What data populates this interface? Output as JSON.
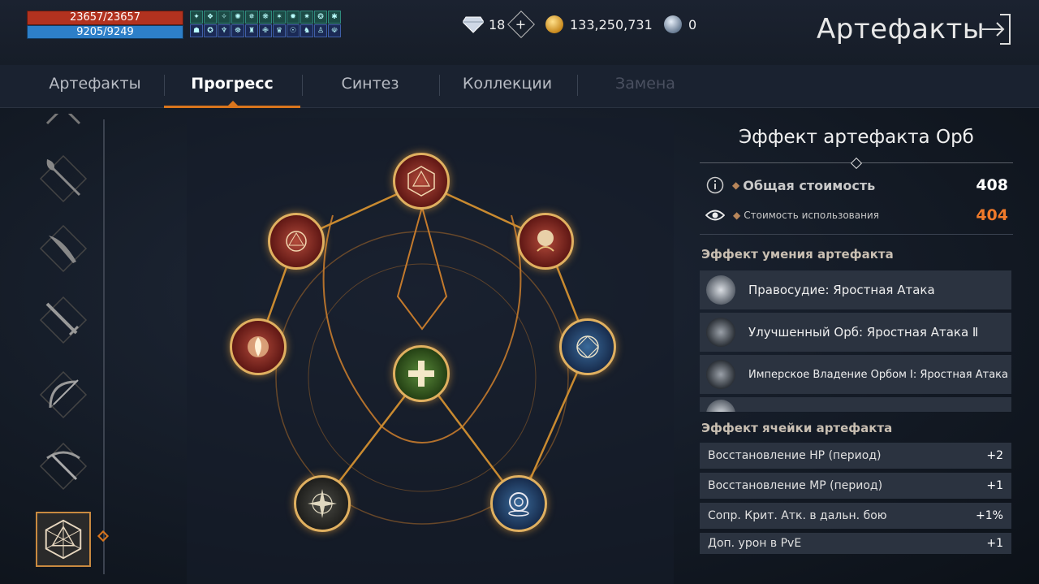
{
  "player": {
    "hp": "23657/23657",
    "mp": "9205/9249"
  },
  "buffs": [
    "✦",
    "❖",
    "✧",
    "✺",
    "✵",
    "❋",
    "✶",
    "✹",
    "✷",
    "❂",
    "✱",
    "☗",
    "✪",
    "♆",
    "☸",
    "♜",
    "✙",
    "♛",
    "☉",
    "♞",
    "♙",
    "☫"
  ],
  "currency": {
    "diamonds": "18",
    "gold": "133,250,731",
    "silver": "0"
  },
  "page_title": "Артефакты",
  "tabs": [
    {
      "label": "Артефакты",
      "state": "normal"
    },
    {
      "label": "Прогресс",
      "state": "active"
    },
    {
      "label": "Синтез",
      "state": "normal"
    },
    {
      "label": "Коллекции",
      "state": "normal"
    },
    {
      "label": "Замена",
      "state": "disabled"
    }
  ],
  "weapons": [
    "staff-icon",
    "halberd-icon",
    "dagger-icon",
    "sword-icon",
    "bow-icon",
    "crossbow-icon",
    "orb-icon"
  ],
  "panel": {
    "title": "Эффект артефакта Орб",
    "total_cost_label": "Общая стоимость",
    "total_cost_value": "408",
    "usage_cost_label": "Стоимость использования",
    "usage_cost_value": "404",
    "skill_section": "Эффект умения артефакта",
    "skills": [
      "Правосудие: Яростная Атака",
      "Улучшенный Орб: Яростная Атака Ⅱ",
      "Имперское Владение Орбом Ⅰ: Яростная Атака"
    ],
    "cell_section": "Эффект ячейки артефакта",
    "cells": [
      {
        "label": "Восстановление HP (период)",
        "value": "+2"
      },
      {
        "label": "Восстановление MP (период)",
        "value": "+1"
      },
      {
        "label": "Сопр. Крит. Атк. в дальн. бою",
        "value": "+1%"
      },
      {
        "label": "Доп. урон в PvE",
        "value": "+1"
      }
    ]
  },
  "colors": {
    "accent": "#d9751d",
    "usage_cost": "#f07a2a",
    "gold_border": "#e0b060"
  }
}
